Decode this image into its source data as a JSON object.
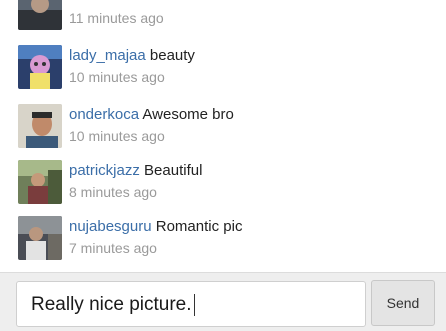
{
  "comments": [
    {
      "username": "",
      "text": "",
      "time": "11 minutes ago",
      "avatar": "avatar-icon"
    },
    {
      "username": "lady_majaa",
      "text": "beauty",
      "time": "10 minutes ago",
      "avatar": "avatar-icon"
    },
    {
      "username": "onderkoca",
      "text": "Awesome bro",
      "time": "10 minutes ago",
      "avatar": "avatar-icon"
    },
    {
      "username": "patrickjazz",
      "text": "Beautiful",
      "time": "8 minutes ago",
      "avatar": "avatar-icon"
    },
    {
      "username": "nujabesguru",
      "text": "Romantic pic",
      "time": "7 minutes ago",
      "avatar": "avatar-icon"
    }
  ],
  "composer": {
    "input_value": "Really nice picture.",
    "send_label": "Send"
  },
  "colors": {
    "username": "#3b6ea8",
    "timestamp": "#9a9a9a",
    "composer_bg": "#eeeeee"
  }
}
